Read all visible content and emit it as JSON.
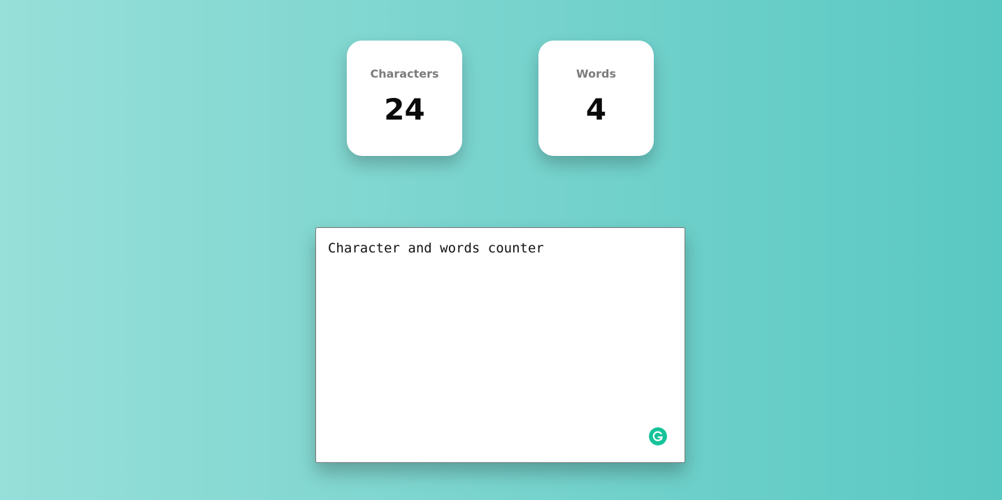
{
  "stats": {
    "characters": {
      "label": "Characters",
      "value": "24"
    },
    "words": {
      "label": "Words",
      "value": "4"
    }
  },
  "editor": {
    "value": "Character and words counter",
    "grammarly_icon": "grammarly-icon"
  },
  "colors": {
    "background_left": "#97dfd9",
    "background_right": "#5ac8c2",
    "grammarly": "#15c39a",
    "label": "#7b7b7b"
  }
}
